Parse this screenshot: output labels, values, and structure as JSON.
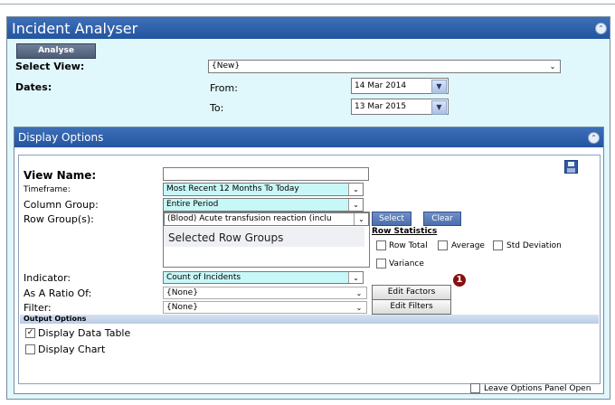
{
  "app": {
    "title": "Incident Analyser"
  },
  "top": {
    "analyse_label": "Analyse",
    "select_view_label": "Select View:",
    "select_view_value": "{New}",
    "dates_label": "Dates:",
    "from_label": "From:",
    "from_value": "14 Mar 2014",
    "to_label": "To:",
    "to_value": "13 Mar 2015"
  },
  "display_options": {
    "title": "Display Options",
    "view_name_label": "View Name:",
    "view_name_value": "",
    "timeframe_label": "Timeframe:",
    "timeframe_value": "Most Recent 12 Months To Today",
    "column_group_label": "Column Group:",
    "column_group_value": "Entire Period",
    "row_groups_label": "Row Group(s):",
    "row_groups_value": "(Blood) Acute transfusion reaction (inclu",
    "select_button": "Select",
    "clear_button": "Clear",
    "selected_row_groups_label": "Selected Row Groups",
    "row_statistics_label": "Row Statistics",
    "row_total_label": "Row Total",
    "average_label": "Average",
    "std_deviation_label": "Std Deviation",
    "variance_label": "Variance",
    "indicator_label": "Indicator:",
    "indicator_value": "Count of Incidents",
    "ratio_label": "As A Ratio Of:",
    "ratio_value": "{None}",
    "edit_factors_button": "Edit Factors",
    "filter_label": "Filter:",
    "filter_value": "{None}",
    "edit_filters_button": "Edit Filters",
    "output_options_label": "Output Options",
    "display_data_table_label": "Display Data Table",
    "display_data_table_checked": true,
    "display_chart_label": "Display Chart",
    "display_chart_checked": false,
    "annotation_badge": "1"
  },
  "footer": {
    "leave_open_label": "Leave Options Panel Open"
  },
  "colors": {
    "title_bar": "#2354a0",
    "window_bg": "#e0f7fb",
    "teal_select": "#c8f7f7",
    "badge": "#8b0f0f"
  },
  "icons": [
    "collapse-icon",
    "save-disk-icon",
    "dropdown-arrow-icon",
    "calendar-dropdown-icon",
    "checkbox-icon"
  ]
}
